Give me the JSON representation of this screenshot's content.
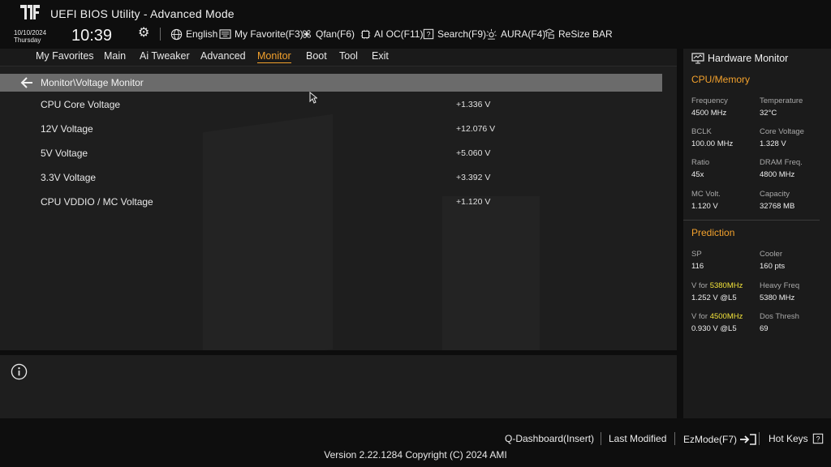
{
  "header": {
    "title": "UEFI BIOS Utility - Advanced Mode",
    "date": "10/10/2024",
    "day": "Thursday",
    "time": "10:39",
    "tools": [
      {
        "label": "English",
        "icon": "globe-icon"
      },
      {
        "label": "My Favorite(F3)",
        "icon": "favorite-keyboard-icon"
      },
      {
        "label": "Qfan(F6)",
        "icon": "fan-icon"
      },
      {
        "label": "AI OC(F11)",
        "icon": "ai-oc-icon"
      },
      {
        "label": "Search(F9)",
        "icon": "search-icon"
      },
      {
        "label": "AURA(F4)",
        "icon": "aura-icon"
      },
      {
        "label": "ReSize BAR",
        "icon": "resize-bar-icon"
      }
    ]
  },
  "menu": {
    "items": [
      "My Favorites",
      "Main",
      "Ai Tweaker",
      "Advanced",
      "Monitor",
      "Boot",
      "Tool",
      "Exit"
    ],
    "active": "Monitor"
  },
  "breadcrumb": "Monitor\\Voltage Monitor",
  "voltages": [
    {
      "label": "CPU Core Voltage",
      "value": "+1.336 V"
    },
    {
      "label": "12V Voltage",
      "value": "+12.076 V"
    },
    {
      "label": "5V Voltage",
      "value": "+5.060 V"
    },
    {
      "label": "3.3V Voltage",
      "value": "+3.392 V"
    },
    {
      "label": "CPU VDDIO / MC Voltage",
      "value": "+1.120 V"
    }
  ],
  "hardware_monitor": {
    "title": "Hardware Monitor",
    "cpu_memory": {
      "section": "CPU/Memory",
      "frequency_label": "Frequency",
      "frequency": "4500 MHz",
      "temperature_label": "Temperature",
      "temperature": "32°C",
      "bclk_label": "BCLK",
      "bclk": "100.00 MHz",
      "core_voltage_label": "Core Voltage",
      "core_voltage": "1.328 V",
      "ratio_label": "Ratio",
      "ratio": "45x",
      "dram_freq_label": "DRAM Freq.",
      "dram_freq": "4800 MHz",
      "mc_volt_label": "MC Volt.",
      "mc_volt": "1.120 V",
      "capacity_label": "Capacity",
      "capacity": "32768 MB"
    },
    "prediction": {
      "section": "Prediction",
      "sp_label": "SP",
      "sp": "116",
      "cooler_label": "Cooler",
      "cooler": "160 pts",
      "v_for_prefix": "V for",
      "v_for_freq1": "5380MHz",
      "v_for_value1": "1.252 V @L5",
      "heavy_freq_label": "Heavy Freq",
      "heavy_freq": "5380 MHz",
      "v_for_freq2": "4500MHz",
      "v_for_value2": "0.930 V @L5",
      "dos_thresh_label": "Dos Thresh",
      "dos_thresh": "69"
    }
  },
  "footer": {
    "items": [
      "Q-Dashboard(Insert)",
      "Last Modified",
      "EzMode(F7)",
      "Hot Keys"
    ],
    "version": "Version 2.22.1284 Copyright (C) 2024 AMI"
  },
  "colors": {
    "accent": "#f3a12c",
    "highlight": "#f2e23a",
    "path_bar": "#6b6b6b",
    "panel": "#1e1e1e"
  }
}
